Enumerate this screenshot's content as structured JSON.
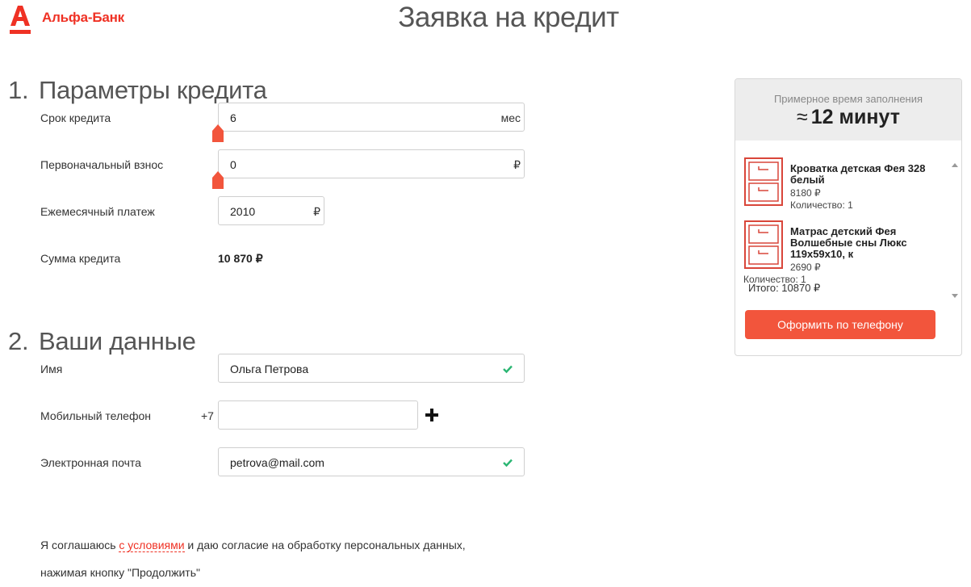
{
  "brand": {
    "name": "Альфа-Банк",
    "color": "#ef3124"
  },
  "page_title": "Заявка на кредит",
  "section1": {
    "number": "1.",
    "title": "Параметры кредита",
    "term": {
      "label": "Срок кредита",
      "value": "6",
      "unit": "мес"
    },
    "down_payment": {
      "label": "Первоначальный взнос",
      "value": "0",
      "unit": "₽"
    },
    "monthly_payment": {
      "label": "Ежемесячный платеж",
      "value": "2010",
      "unit": "₽"
    },
    "credit_sum": {
      "label": "Сумма кредита",
      "value": "10 870 ₽"
    }
  },
  "section2": {
    "number": "2.",
    "title": "Ваши данные",
    "name": {
      "label": "Имя",
      "value": "Ольга Петрова"
    },
    "phone": {
      "label": "Мобильный телефон",
      "prefix": "+7",
      "value": ""
    },
    "email": {
      "label": "Электронная почта",
      "value": "petrova@mail.com"
    }
  },
  "consent": {
    "before": "Я соглашаюсь ",
    "link": "с условиями",
    "after": " и даю согласие на обработку персональных данных,",
    "line2": "нажимая кнопку \"Продолжить\""
  },
  "side_panel": {
    "time_label": "Примерное время заполнения",
    "time_approx": "≈",
    "time_value": "12 минут",
    "items": [
      {
        "name": "Кроватка детская Фея 328 белый",
        "price": "8180 ₽",
        "quantity": "Количество: 1"
      },
      {
        "name": "Матрас детский Фея Волшебные сны Люкс 119х59х10, к",
        "price": "2690 ₽",
        "quantity": "Количество: 1"
      }
    ],
    "total": "Итого: 10870 ₽",
    "button_label": "Оформить по телефону"
  },
  "colors": {
    "accent": "#ef3124",
    "button": "#f2553c",
    "check": "#2bb673"
  },
  "icons": {
    "check": "check-icon",
    "plus": "plus-icon",
    "slider": "slider-handle-icon",
    "product": "cabinet-icon"
  }
}
